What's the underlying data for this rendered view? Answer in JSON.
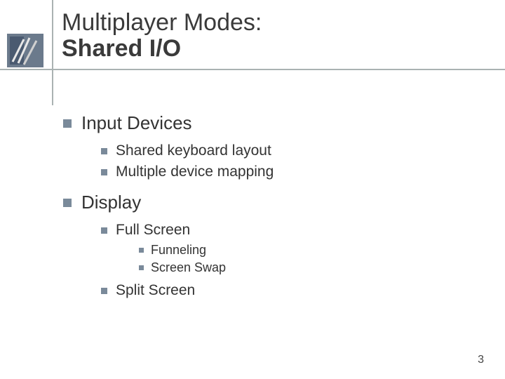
{
  "title": {
    "line1": "Multiplayer Modes:",
    "line2": "Shared I/O"
  },
  "content": {
    "items": [
      {
        "label": "Input Devices",
        "children": [
          {
            "label": "Shared keyboard layout"
          },
          {
            "label": "Multiple device mapping"
          }
        ]
      },
      {
        "label": "Display",
        "children": [
          {
            "label": "Full Screen",
            "children": [
              {
                "label": "Funneling"
              },
              {
                "label": "Screen Swap"
              }
            ]
          },
          {
            "label": "Split Screen"
          }
        ]
      }
    ]
  },
  "page_number": "3"
}
